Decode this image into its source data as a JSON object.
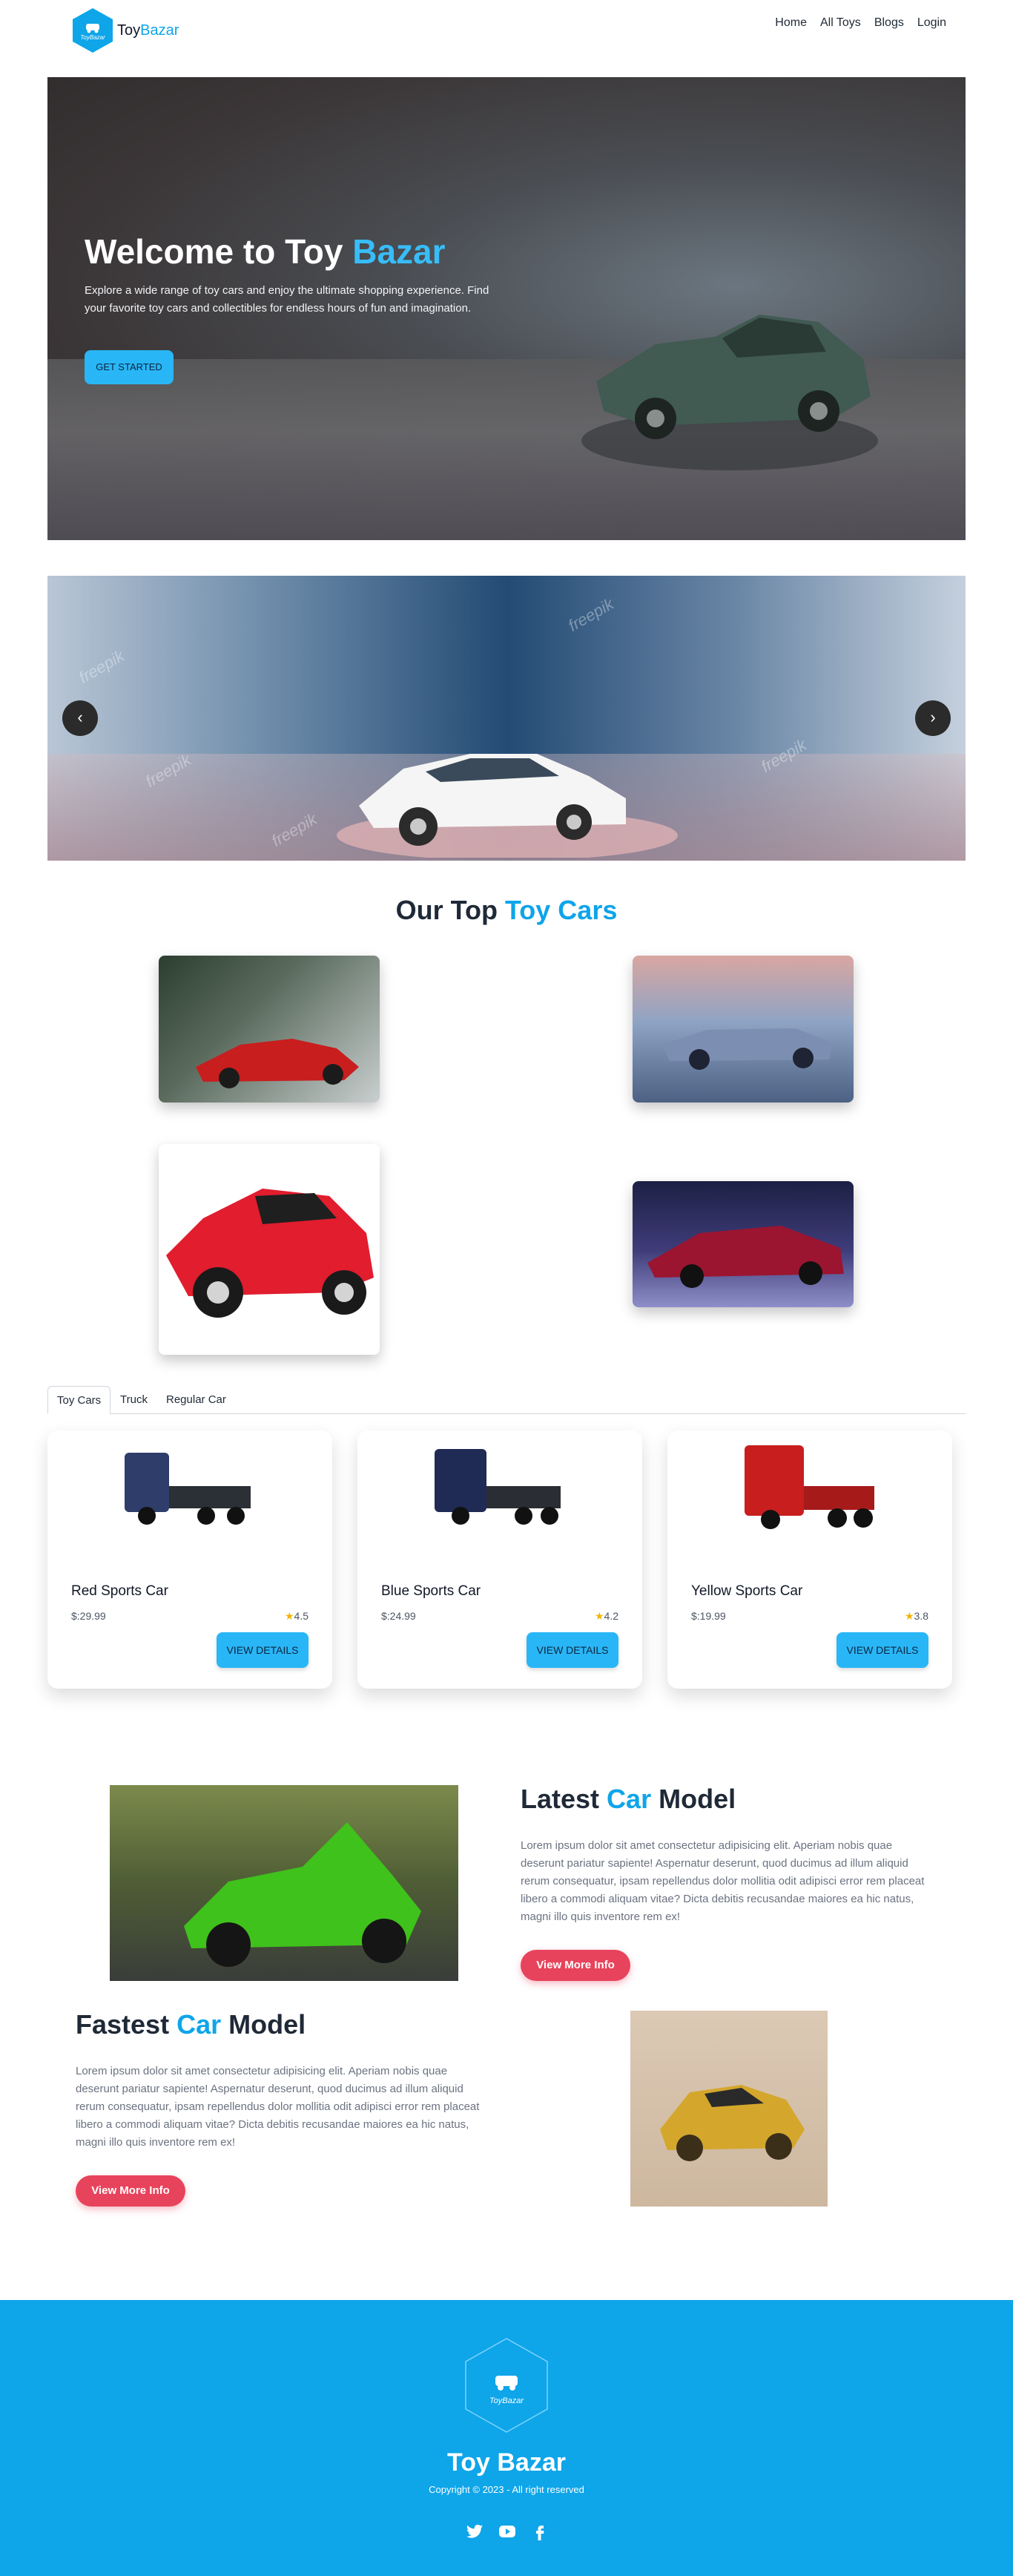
{
  "nav": {
    "logo_mini": "ToyBazar",
    "logo_main": "Toy",
    "logo_accent": "Bazar",
    "items": [
      "Home",
      "All Toys",
      "Blogs",
      "Login"
    ]
  },
  "hero": {
    "title_main": "Welcome to Toy",
    "title_accent": "Bazar",
    "subtitle": "Explore a wide range of toy cars and enjoy the ultimate shopping experience. Find your favorite toy cars and collectibles for endless hours of fun and imagination.",
    "cta": "GET STARTED"
  },
  "carousel": {
    "prev": "‹",
    "next": "›",
    "watermark": "freepik"
  },
  "top_cars": {
    "title_main": "Our Top",
    "title_accent": "Toy Cars"
  },
  "tabs": [
    "Toy Cars",
    "Truck",
    "Regular Car"
  ],
  "products": [
    {
      "name": "Red Sports Car",
      "price": "$:29.99",
      "rating": "4.5",
      "button": "VIEW DETAILS"
    },
    {
      "name": "Blue Sports Car",
      "price": "$:24.99",
      "rating": "4.2",
      "button": "VIEW DETAILS"
    },
    {
      "name": "Yellow Sports Car",
      "price": "$:19.99",
      "rating": "3.8",
      "button": "VIEW DETAILS"
    }
  ],
  "latest": {
    "title_main": "Latest",
    "title_accent": "Car",
    "title_end": "Model",
    "text": "Lorem ipsum dolor sit amet consectetur adipisicing elit. Aperiam nobis quae deserunt pariatur sapiente! Aspernatur deserunt, quod ducimus ad illum aliquid rerum consequatur, ipsam repellendus dolor mollitia odit adipisci error rem placeat libero a commodi aliquam vitae? Dicta debitis recusandae maiores ea hic natus, magni illo quis inventore rem ex!",
    "button": "View More Info"
  },
  "fastest": {
    "title_main": "Fastest",
    "title_accent": "Car",
    "title_end": "Model",
    "text": "Lorem ipsum dolor sit amet consectetur adipisicing elit. Aperiam nobis quae deserunt pariatur sapiente! Aspernatur deserunt, quod ducimus ad illum aliquid rerum consequatur, ipsam repellendus dolor mollitia odit adipisci error rem placeat libero a commodi aliquam vitae? Dicta debitis recusandae maiores ea hic natus, magni illo quis inventore rem ex!",
    "button": "View More Info"
  },
  "footer": {
    "logo_mini": "ToyBazar",
    "title": "Toy Bazar",
    "copyright": "Copyright © 2023 - All right reserved",
    "socials": [
      "twitter-icon",
      "youtube-icon",
      "facebook-icon"
    ]
  },
  "colors": {
    "accent": "#0ea5e9",
    "button": "#29b6f6",
    "cta_pink": "#e8435c",
    "footer": "#0ea5e9"
  }
}
